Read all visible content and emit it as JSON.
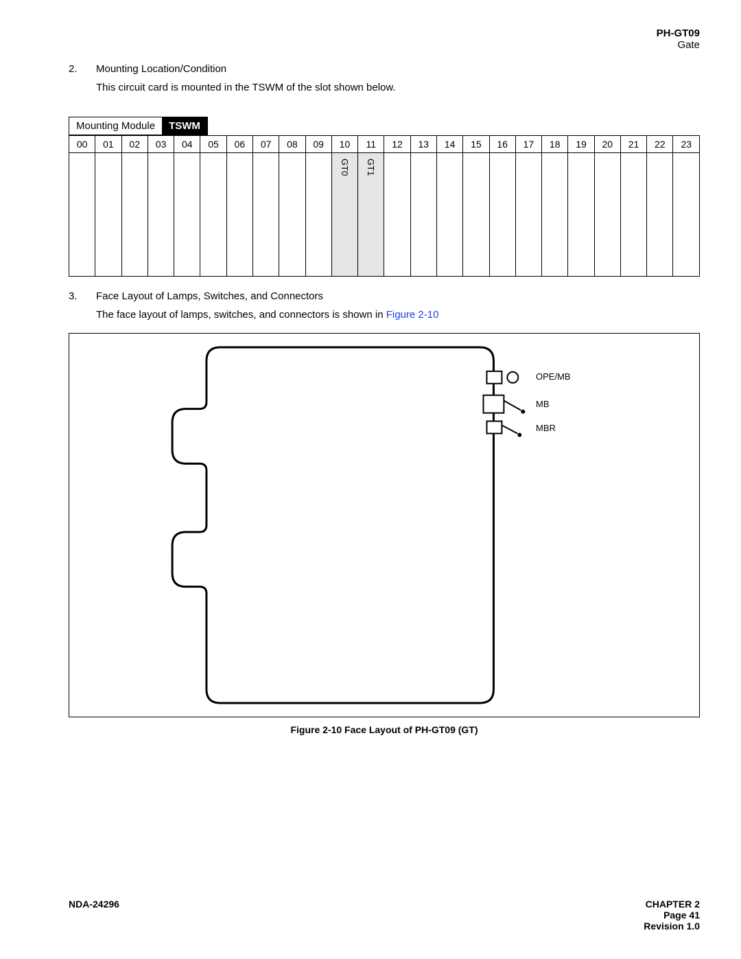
{
  "header": {
    "model": "PH-GT09",
    "subtitle": "Gate"
  },
  "section2": {
    "num": "2.",
    "title": "Mounting Location/Condition",
    "body": "This circuit card is mounted in the TSWM of the slot shown below."
  },
  "module": {
    "label": "Mounting Module",
    "name": "TSWM",
    "slots": [
      "00",
      "01",
      "02",
      "03",
      "04",
      "05",
      "06",
      "07",
      "08",
      "09",
      "10",
      "11",
      "12",
      "13",
      "14",
      "15",
      "16",
      "17",
      "18",
      "19",
      "20",
      "21",
      "22",
      "23"
    ],
    "slot10": "GT0",
    "slot11": "GT1"
  },
  "section3": {
    "num": "3.",
    "title": "Face Layout of Lamps, Switches, and Connectors",
    "body_pre": "The face layout of lamps, switches, and connectors is shown in ",
    "link": "Figure 2-10"
  },
  "connectors": {
    "lbl1": "OPE/MB",
    "lbl2": "MB",
    "lbl3": "MBR"
  },
  "figure_caption": "Figure 2-10   Face Layout of PH-GT09 (GT)",
  "footer": {
    "doc": "NDA-24296",
    "chapter": "CHAPTER 2",
    "page": "Page 41",
    "revision": "Revision 1.0"
  }
}
